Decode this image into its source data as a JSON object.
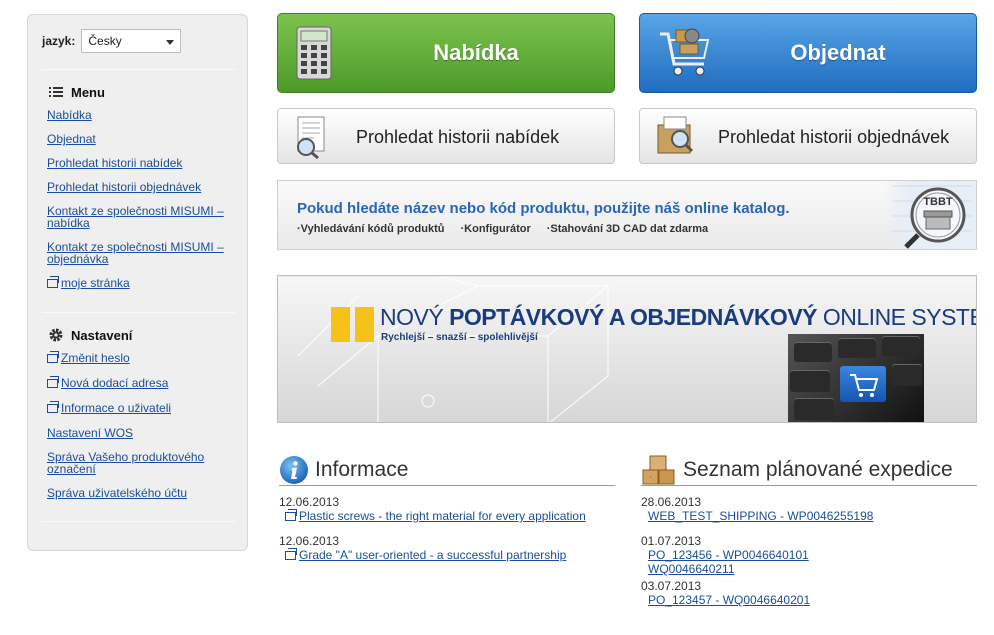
{
  "sidebar": {
    "lang_label": "jazyk:",
    "lang_value": "Česky",
    "menu": {
      "title": "Menu",
      "items": [
        {
          "label": "Nabídka",
          "popup": false
        },
        {
          "label": "Objednat",
          "popup": false
        },
        {
          "label": "Prohledat historii nabídek",
          "popup": false
        },
        {
          "label": "Prohledat historii objednávek",
          "popup": false
        },
        {
          "label": "Kontakt ze společnosti MISUMI – nabídka",
          "popup": false
        },
        {
          "label": "Kontakt ze společnosti MISUMI – objednávka",
          "popup": false
        },
        {
          "label": "moje stránka",
          "popup": true
        }
      ]
    },
    "settings": {
      "title": "Nastavení",
      "items": [
        {
          "label": "Změnit heslo",
          "popup": true
        },
        {
          "label": "Nová dodací adresa",
          "popup": true
        },
        {
          "label": "Informace o uživateli",
          "popup": true
        },
        {
          "label": "Nastavení WOS",
          "popup": false
        },
        {
          "label": "Správa Vašeho produktového označení",
          "popup": false
        },
        {
          "label": "Správa uživatelského účtu",
          "popup": false
        }
      ]
    }
  },
  "buttons": {
    "quote": "Nabídka",
    "order": "Objednat",
    "quote_history": "Prohledat historii nabídek",
    "order_history": "Prohledat historii objednávek"
  },
  "catalog": {
    "title": "Pokud hledáte název nebo kód produktu, použijte náš online katalog.",
    "links": [
      "·Vyhledávání kódů produktů",
      "·Konfigurátor",
      "·Stahování 3D CAD dat zdarma"
    ],
    "badge": "TBBT"
  },
  "system_banner": {
    "head_light": "NOVÝ ",
    "head_bold": "POPTÁVKOVÝ A OBJEDNÁVKOVÝ",
    "head_tail": " ONLINE SYSTÉM",
    "tagline": "Rychlejší – snazší – spolehlivější"
  },
  "info": {
    "title": "Informace",
    "items": [
      {
        "date": "12.06.2013",
        "text": "Plastic screws - the right material for every application"
      },
      {
        "date": "12.06.2013",
        "text": "Grade \"A\" user-oriented - a successful partnership"
      }
    ]
  },
  "shipping": {
    "title": "Seznam plánované expedice",
    "items": [
      {
        "date": "28.06.2013",
        "lines": [
          "WEB_TEST_SHIPPING - WP0046255198"
        ]
      },
      {
        "date": "01.07.2013",
        "lines": [
          "PO_123456 - WP0046640101",
          "WQ0046640211"
        ]
      },
      {
        "date": "03.07.2013",
        "lines": [
          "PO_123457 - WQ0046640201"
        ]
      }
    ]
  },
  "colors": {
    "link": "#1a4e9c",
    "green_button": "#5aa834",
    "blue_button": "#2f82d3",
    "banner_yellow": "#f6c21a",
    "banner_navy": "#1a3c7e"
  }
}
